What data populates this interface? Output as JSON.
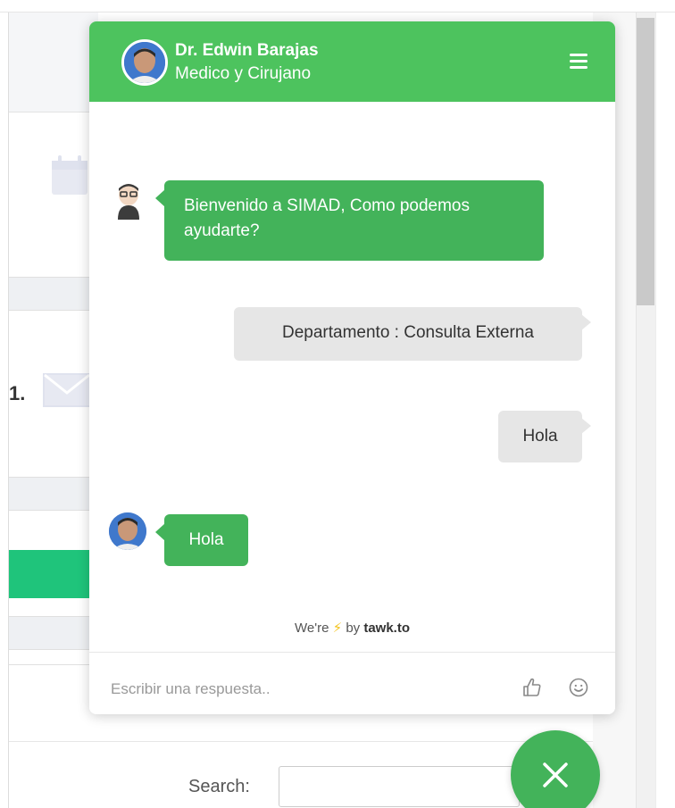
{
  "colors": {
    "header_green": "#4dc35e",
    "bubble_green": "#43b35a",
    "visitor_bubble": "#e6e6e6",
    "background_green_bar": "#1fc47b"
  },
  "chat": {
    "agent": {
      "name": "Dr. Edwin Barajas",
      "role": "Medico y Cirujano",
      "menu_icon": "hamburger-menu-icon"
    },
    "messages": [
      {
        "sender": "bot",
        "text": "Bienvenido a SIMAD, Como podemos ayudarte?"
      },
      {
        "sender": "visitor",
        "text": "Departamento : Consulta Externa"
      },
      {
        "sender": "visitor",
        "text": "Hola"
      },
      {
        "sender": "agent",
        "text": "Hola"
      }
    ],
    "powered_by": {
      "prefix": "We're",
      "icon": "lightning-bolt-icon",
      "middle": "by",
      "brand": "tawk.to"
    },
    "composer": {
      "placeholder": "Escribir una respuesta..",
      "value": ""
    }
  },
  "background_page": {
    "search_label": "Search:",
    "partial_text": "1."
  }
}
